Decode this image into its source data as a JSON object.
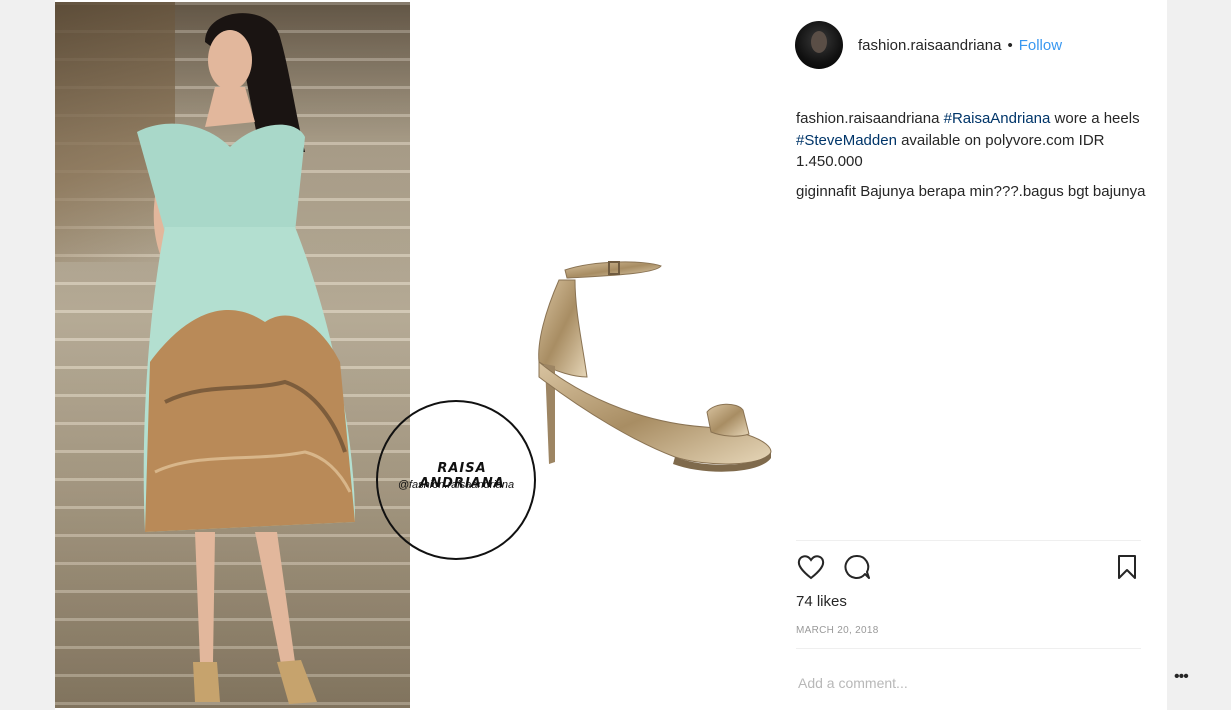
{
  "media": {
    "watermark_brand": "RAISA ANDRIANA",
    "watermark_handle": "@fashion.raisaandriana"
  },
  "header": {
    "username": "fashion.raisaandriana",
    "separator": "•",
    "follow_label": "Follow"
  },
  "caption": {
    "username": "fashion.raisaandriana",
    "tag1": "#RaisaAndriana",
    "text1": " wore a heels ",
    "tag2": "#SteveMadden",
    "text2": " available on polyvore.com IDR 1.450.000"
  },
  "comments": [
    {
      "username": "giginnafit",
      "text": " Bajunya berapa min???.bagus bgt bajunya"
    }
  ],
  "actions": {
    "like_icon": "heart-icon",
    "comment_icon": "speech-bubble-icon",
    "save_icon": "bookmark-icon"
  },
  "likes": "74 likes",
  "date": "MARCH 20, 2018",
  "add_comment": {
    "placeholder": "Add a comment..."
  },
  "more_label": "•••"
}
